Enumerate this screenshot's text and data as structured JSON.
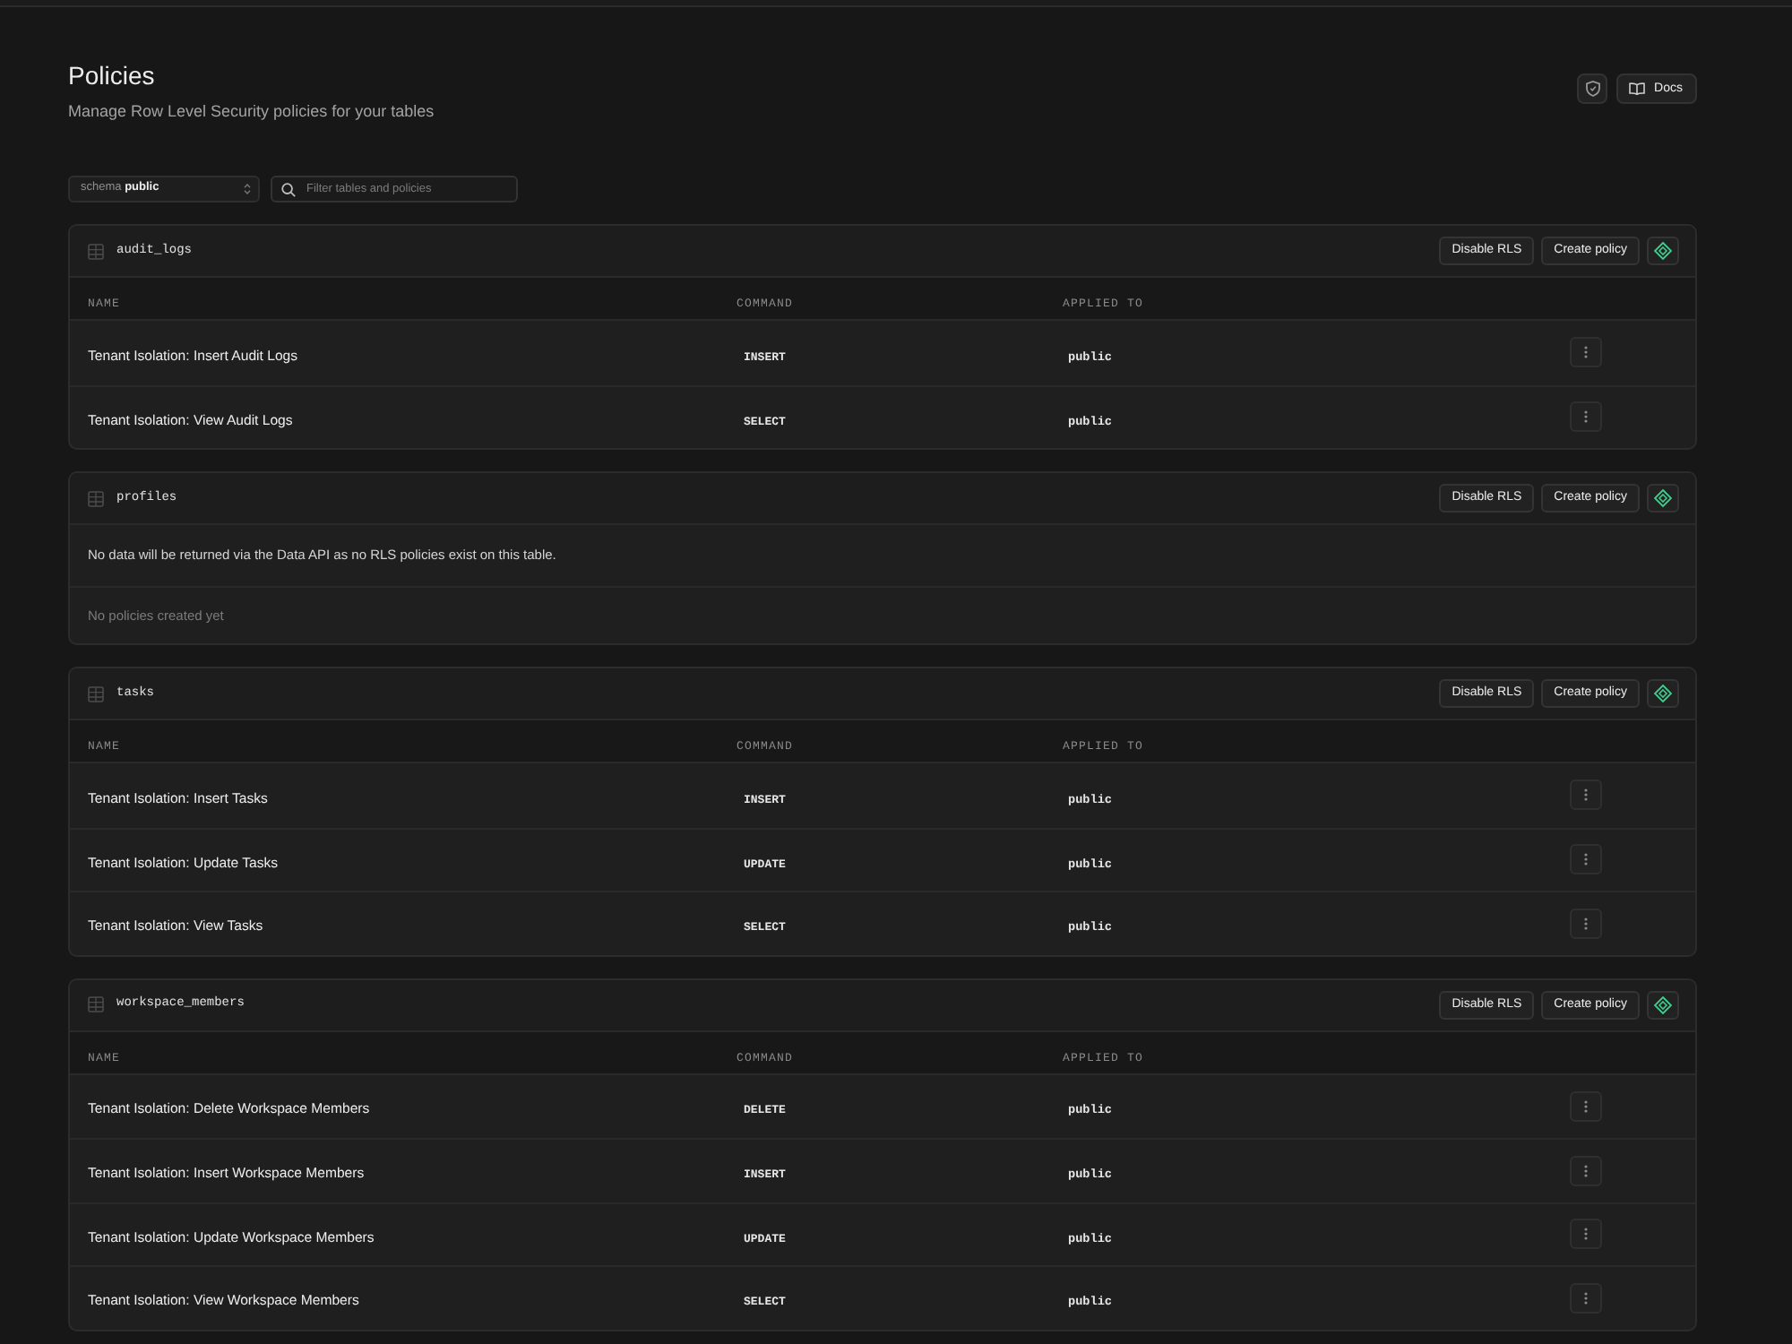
{
  "page": {
    "title": "Policies",
    "subtitle": "Manage Row Level Security policies for your tables",
    "docs_label": "Docs"
  },
  "filters": {
    "schema_label": "schema",
    "schema_value": "public",
    "search_placeholder": "Filter tables and policies"
  },
  "tables": [
    {
      "name": "audit_logs",
      "actions": [
        "Disable RLS",
        "Create policy"
      ],
      "columns": [
        "NAME",
        "COMMAND",
        "APPLIED TO"
      ],
      "policies": [
        {
          "name": "Tenant Isolation: Insert Audit Logs",
          "command": "INSERT",
          "applied_to": "public"
        },
        {
          "name": "Tenant Isolation: View Audit Logs",
          "command": "SELECT",
          "applied_to": "public"
        }
      ]
    },
    {
      "name": "profiles",
      "actions": [
        "Disable RLS",
        "Create policy"
      ],
      "notice": "No data will be returned via the Data API as no RLS policies exist on this table.",
      "empty_text": "No policies created yet"
    },
    {
      "name": "tasks",
      "actions": [
        "Disable RLS",
        "Create policy"
      ],
      "columns": [
        "NAME",
        "COMMAND",
        "APPLIED TO"
      ],
      "policies": [
        {
          "name": "Tenant Isolation: Insert Tasks",
          "command": "INSERT",
          "applied_to": "public"
        },
        {
          "name": "Tenant Isolation: Update Tasks",
          "command": "UPDATE",
          "applied_to": "public"
        },
        {
          "name": "Tenant Isolation: View Tasks",
          "command": "SELECT",
          "applied_to": "public"
        }
      ]
    },
    {
      "name": "workspace_members",
      "actions": [
        "Disable RLS",
        "Create policy"
      ],
      "columns": [
        "NAME",
        "COMMAND",
        "APPLIED TO"
      ],
      "policies": [
        {
          "name": "Tenant Isolation: Delete Workspace Members",
          "command": "DELETE",
          "applied_to": "public"
        },
        {
          "name": "Tenant Isolation: Insert Workspace Members",
          "command": "INSERT",
          "applied_to": "public"
        },
        {
          "name": "Tenant Isolation: Update Workspace Members",
          "command": "UPDATE",
          "applied_to": "public"
        },
        {
          "name": "Tenant Isolation: View Workspace Members",
          "command": "SELECT",
          "applied_to": "public"
        }
      ]
    }
  ]
}
